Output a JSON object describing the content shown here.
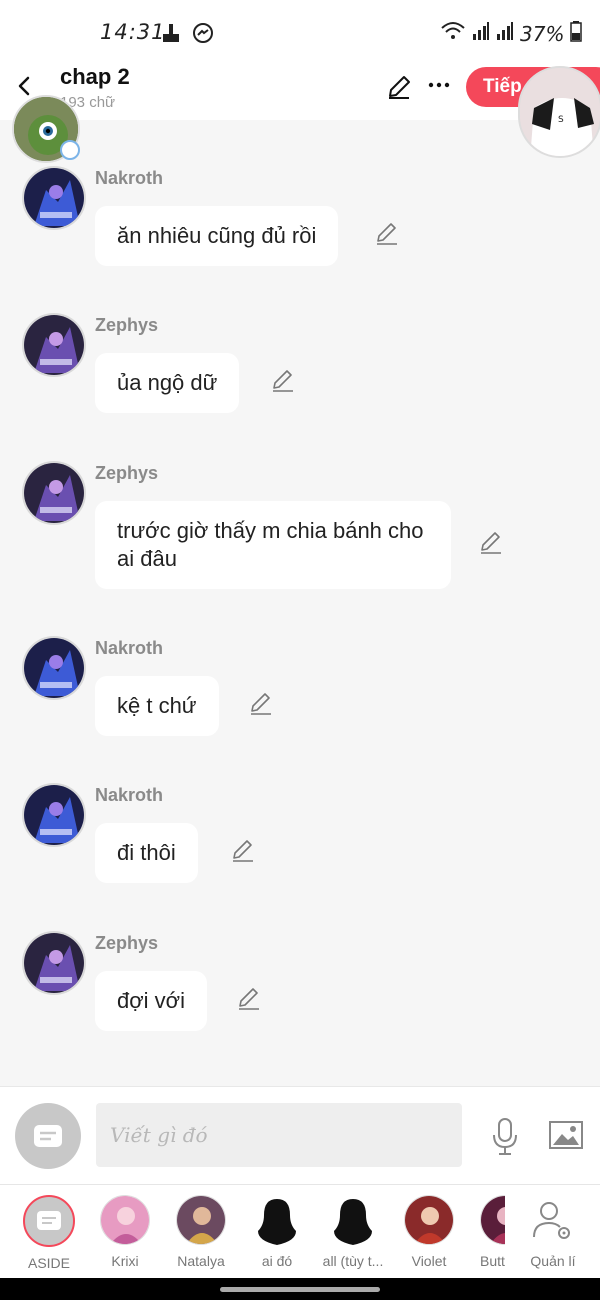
{
  "status_bar": {
    "time": "14:31",
    "battery": "37%"
  },
  "header": {
    "title": "chap 2",
    "word_count": "193 chữ",
    "next_label": "Tiếp"
  },
  "messages": [
    {
      "sender": "Nakroth",
      "text": "ăn nhiêu cũng đủ rồi"
    },
    {
      "sender": "Zephys",
      "text": "ủa ngộ dữ"
    },
    {
      "sender": "Zephys",
      "text": "trước giờ thấy m chia bánh cho ai đâu"
    },
    {
      "sender": "Nakroth",
      "text": "kệ t chứ"
    },
    {
      "sender": "Nakroth",
      "text": "đi thôi"
    },
    {
      "sender": "Zephys",
      "text": "đợi với"
    }
  ],
  "composer": {
    "placeholder": "Viết gì đó"
  },
  "characters": [
    {
      "name": "ASIDE"
    },
    {
      "name": "Krixi"
    },
    {
      "name": "Natalya"
    },
    {
      "name": "ai đó"
    },
    {
      "name": "all (tùy t..."
    },
    {
      "name": "Violet"
    },
    {
      "name": "Butt"
    },
    {
      "name": "Quản lí"
    }
  ],
  "colors": {
    "accent": "#f4485a",
    "background": "#f6f6f6",
    "bubble": "#ffffff",
    "sender_name": "#8a8a8a"
  }
}
